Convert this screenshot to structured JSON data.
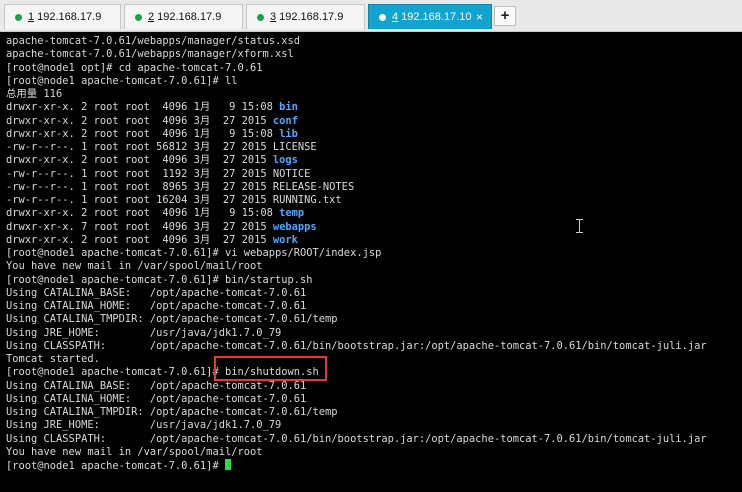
{
  "tabs": [
    {
      "index": "1",
      "label": "192.168.17.9"
    },
    {
      "index": "2",
      "label": "192.168.17.9"
    },
    {
      "index": "3",
      "label": "192.168.17.9"
    },
    {
      "index": "4",
      "label": "192.168.17.10"
    }
  ],
  "new_tab_label": "+",
  "tab_close": "×",
  "colors": {
    "active_tab": "#12a4cf",
    "status_dot": "#16a34a",
    "dir_blue": "#4fa8ff",
    "cursor": "#22e33d",
    "highlight": "#e53935"
  },
  "terminal": {
    "lines": [
      {
        "text": "apache-tomcat-7.0.61/webapps/manager/status.xsd"
      },
      {
        "text": "apache-tomcat-7.0.61/webapps/manager/xform.xsl"
      },
      {
        "text": "[root@node1 opt]# cd apache-tomcat-7.0.61"
      },
      {
        "text": "[root@node1 apache-tomcat-7.0.61]# ll"
      },
      {
        "text": "总用量 116"
      },
      {
        "text": "drwxr-xr-x. 2 root root  4096 1月   9 15:08 ",
        "dir": "bin"
      },
      {
        "text": "drwxr-xr-x. 2 root root  4096 3月  27 2015 ",
        "dir": "conf"
      },
      {
        "text": "drwxr-xr-x. 2 root root  4096 1月   9 15:08 ",
        "dir": "lib"
      },
      {
        "text": "-rw-r--r--. 1 root root 56812 3月  27 2015 LICENSE"
      },
      {
        "text": "drwxr-xr-x. 2 root root  4096 3月  27 2015 ",
        "dir": "logs"
      },
      {
        "text": "-rw-r--r--. 1 root root  1192 3月  27 2015 NOTICE"
      },
      {
        "text": "-rw-r--r--. 1 root root  8965 3月  27 2015 RELEASE-NOTES"
      },
      {
        "text": "-rw-r--r--. 1 root root 16204 3月  27 2015 RUNNING.txt"
      },
      {
        "text": "drwxr-xr-x. 2 root root  4096 1月   9 15:08 ",
        "dir": "temp"
      },
      {
        "text": "drwxr-xr-x. 7 root root  4096 3月  27 2015 ",
        "dir": "webapps"
      },
      {
        "text": "drwxr-xr-x. 2 root root  4096 3月  27 2015 ",
        "dir": "work"
      },
      {
        "text": "[root@node1 apache-tomcat-7.0.61]# vi webapps/ROOT/index.jsp"
      },
      {
        "text": "You have new mail in /var/spool/mail/root"
      },
      {
        "text": "[root@node1 apache-tomcat-7.0.61]# bin/startup.sh"
      },
      {
        "text": "Using CATALINA_BASE:   /opt/apache-tomcat-7.0.61"
      },
      {
        "text": "Using CATALINA_HOME:   /opt/apache-tomcat-7.0.61"
      },
      {
        "text": "Using CATALINA_TMPDIR: /opt/apache-tomcat-7.0.61/temp"
      },
      {
        "text": "Using JRE_HOME:        /usr/java/jdk1.7.0_79"
      },
      {
        "text": "Using CLASSPATH:       /opt/apache-tomcat-7.0.61/bin/bootstrap.jar:/opt/apache-tomcat-7.0.61/bin/tomcat-juli.jar"
      },
      {
        "text": "Tomcat started."
      },
      {
        "text": "[root@node1 apache-tomcat-7.0.61]# bin/shutdown.sh"
      },
      {
        "text": "Using CATALINA_BASE:   /opt/apache-tomcat-7.0.61"
      },
      {
        "text": "Using CATALINA_HOME:   /opt/apache-tomcat-7.0.61"
      },
      {
        "text": "Using CATALINA_TMPDIR: /opt/apache-tomcat-7.0.61/temp"
      },
      {
        "text": "Using JRE_HOME:        /usr/java/jdk1.7.0_79"
      },
      {
        "text": "Using CLASSPATH:       /opt/apache-tomcat-7.0.61/bin/bootstrap.jar:/opt/apache-tomcat-7.0.61/bin/tomcat-juli.jar"
      },
      {
        "text": "You have new mail in /var/spool/mail/root"
      },
      {
        "text": "[root@node1 apache-tomcat-7.0.61]# ",
        "cursor": true
      }
    ]
  }
}
